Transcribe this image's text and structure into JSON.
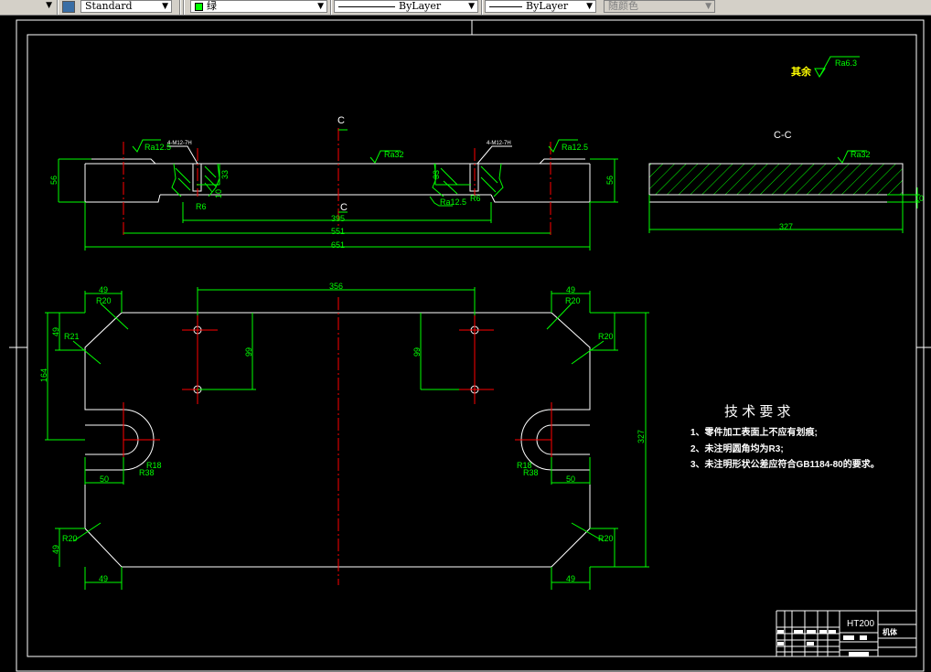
{
  "toolbar": {
    "text_style": "Standard",
    "color": "绿",
    "color_swatch": "#00ff00",
    "linetype": "ByLayer",
    "lineweight": "ByLayer",
    "plot_style": "随颜色"
  },
  "drawing": {
    "section_mark": "C",
    "section_title": "C-C",
    "roughness_rest_label": "其余",
    "roughness_rest_value": "Ra6.3",
    "thread_callout": "4-M12-7H",
    "roughness": {
      "ra32": "Ra32",
      "ra125": "Ra12.5"
    },
    "front_dims": {
      "height": "56",
      "d395": "395",
      "d551": "551",
      "d651": "651",
      "depth": "33",
      "small": "10",
      "radius": "R6"
    },
    "section_dims": {
      "width": "327",
      "small": "10"
    },
    "plan_dims": {
      "d356": "356",
      "d99": "99",
      "d49": "49",
      "d164": "164",
      "d50": "50",
      "d327": "327",
      "r20": "R20",
      "r21": "R21",
      "r18": "R18",
      "r38": "R38"
    },
    "tech_requirements": {
      "title": "技 术 要 求",
      "items": [
        "1、零件加工表面上不应有划痕;",
        "2、未注明圆角均为R3;",
        "3、未注明形状公差应符合GB1184-80的要求。"
      ]
    },
    "title_block": {
      "material": "HT200",
      "part_name": "机体"
    },
    "colors": {
      "background": "#000000",
      "geometry": "#ffffff",
      "dimension": "#00ff00",
      "centerline": "#ff0000",
      "annotation": "#ffff00"
    }
  }
}
